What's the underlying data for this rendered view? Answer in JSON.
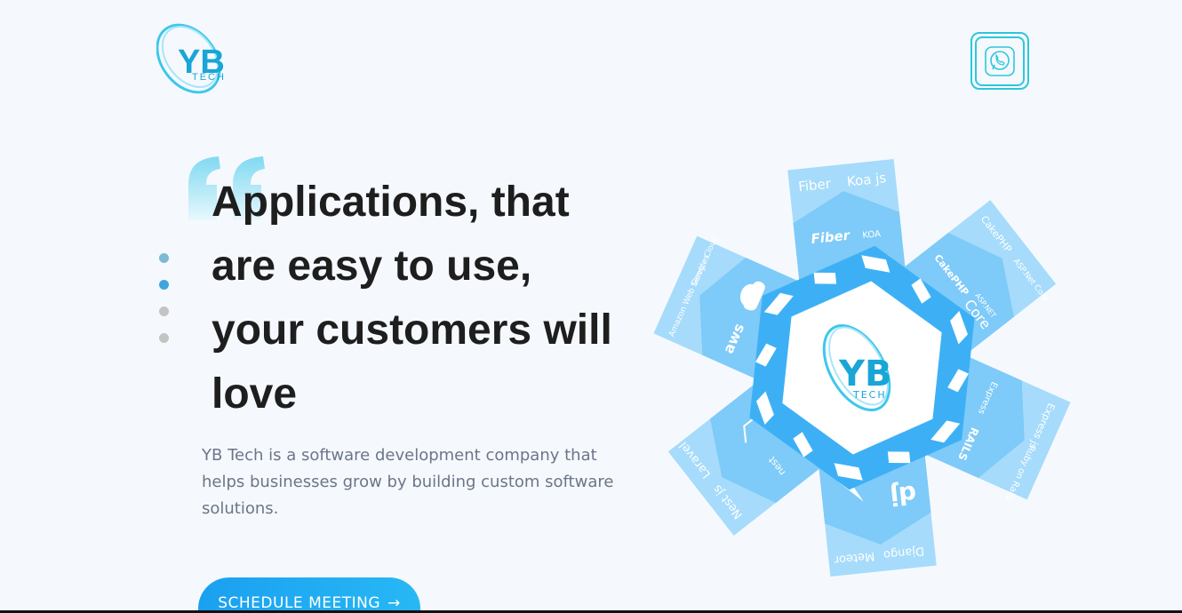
{
  "brand": {
    "logo_text": "YB",
    "logo_subtext": "TECH"
  },
  "header": {
    "whatsapp_icon": "whatsapp-icon"
  },
  "hero": {
    "headline_lines": [
      "Applications, that",
      "are easy to use,",
      "your customers will",
      "love"
    ],
    "description": "YB Tech is a software development company that helps businesses grow by building custom software solutions.",
    "cta_label": "SCHEDULE MEETING",
    "cta_arrow": "→"
  },
  "carousel": {
    "dots": [
      {
        "color": "#7db9d4",
        "active": false
      },
      {
        "color": "#3fa6dc",
        "active": true
      },
      {
        "color": "#c4c4c4",
        "active": false
      },
      {
        "color": "#c4c4c4",
        "active": false
      }
    ]
  },
  "tech_graphic": {
    "center_logo_text": "YB",
    "center_logo_subtext": "TECH",
    "arms": {
      "top": {
        "labels": [
          "Fiber",
          "Koa js"
        ],
        "logos": [
          "Fiber",
          "KOA"
        ]
      },
      "top_right": {
        "labels": [
          "CakePHP",
          "ASP.Net Core"
        ],
        "logos": [
          "CakePHP",
          "ASP.NET",
          "Core"
        ]
      },
      "bottom_right": {
        "labels": [
          "Express js",
          "Ruby on Rails"
        ],
        "logos": [
          "Express",
          "RAILS"
        ]
      },
      "bottom": {
        "labels": [
          "Django",
          "Meteor"
        ],
        "logos": [
          "dj"
        ]
      },
      "bottom_left": {
        "labels": [
          "Nest js",
          "Laravel"
        ],
        "logos": [
          "nest"
        ]
      },
      "top_left": {
        "labels": [
          "Amazon Web Services",
          "Google Cloud"
        ],
        "logos": [
          "aws"
        ]
      }
    }
  },
  "colors": {
    "accent": "#27b8f4",
    "hex_inner": "#3db0f5",
    "arm_light": "#a6dbfb",
    "arm_mid": "#7ecaf8",
    "text_dark": "#1e1e1e",
    "text_muted": "#6c7589"
  }
}
